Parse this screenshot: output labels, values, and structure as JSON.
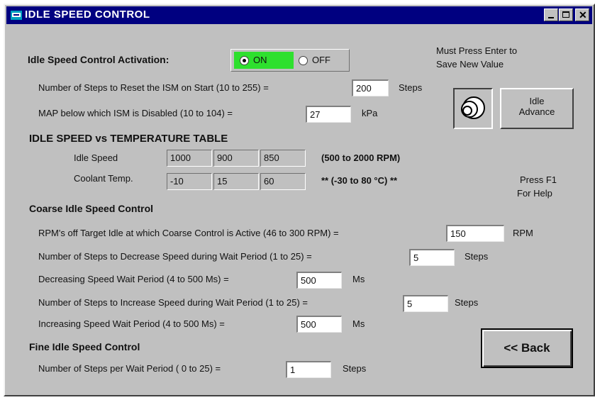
{
  "window": {
    "title": "IDLE SPEED CONTROL",
    "controls": {
      "minimize": "minimize-icon",
      "maximize": "maximize-icon",
      "close": "close-icon"
    }
  },
  "activation": {
    "label": "Idle Speed Control Activation:",
    "on_label": "ON",
    "off_label": "OFF",
    "selected": "ON",
    "on_color": "#2ee02e"
  },
  "note_enter": {
    "line1": "Must Press Enter to",
    "line2": "Save New Value"
  },
  "reset_steps": {
    "label": "Number of Steps to Reset the ISM on Start (10 to 255) =",
    "value": "200",
    "unit": "Steps"
  },
  "map_disable": {
    "label": "MAP below which ISM is Disabled (10 to 104) =",
    "value": "27",
    "unit": "kPa"
  },
  "idle_advance": {
    "label_line1": "Idle",
    "label_line2": "Advance"
  },
  "temp_table": {
    "heading": "IDLE SPEED vs TEMPERATURE TABLE",
    "rows": [
      {
        "label": "Idle Speed",
        "values": [
          "1000",
          "900",
          "850"
        ],
        "range": "(500 to 2000 RPM)"
      },
      {
        "label": "Coolant Temp.",
        "values": [
          "-10",
          "15",
          "60"
        ],
        "range": "** (-30 to 80 °C) **"
      }
    ]
  },
  "help_note": {
    "line1": "Press F1",
    "line2": "For Help"
  },
  "coarse": {
    "heading": "Coarse Idle Speed Control",
    "rows": [
      {
        "label": "RPM's off Target Idle at which Coarse Control is Active (46 to 300 RPM) =",
        "value": "150",
        "unit": "RPM"
      },
      {
        "label": "Number of Steps to Decrease Speed during Wait Period (1 to 25) =",
        "value": "5",
        "unit": "Steps"
      },
      {
        "label": "Decreasing Speed Wait Period (4 to 500 Ms) =",
        "value": "500",
        "unit": "Ms"
      },
      {
        "label": "Number of Steps to Increase Speed during Wait Period (1 to 25) =",
        "value": "5",
        "unit": "Steps"
      },
      {
        "label": "Increasing Speed Wait Period (4 to 500 Ms) =",
        "value": "500",
        "unit": "Ms"
      }
    ]
  },
  "fine": {
    "heading": "Fine Idle Speed Control",
    "label": "Number of Steps per Wait Period ( 0 to 25) =",
    "value": "1",
    "unit": "Steps"
  },
  "back_button": {
    "label": "<< Back"
  }
}
